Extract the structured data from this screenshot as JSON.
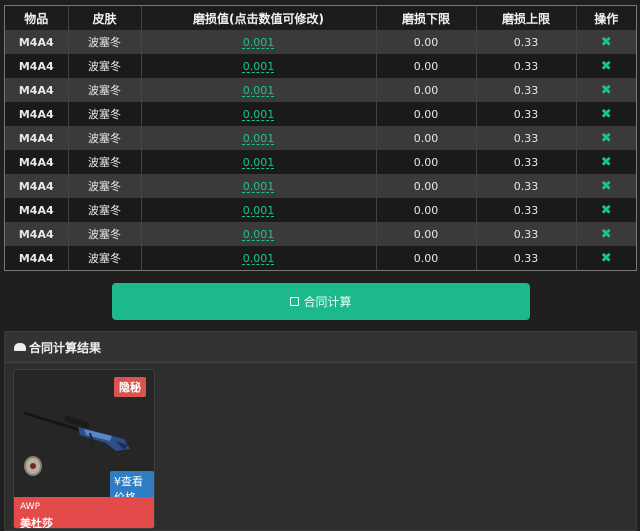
{
  "table": {
    "headers": {
      "item": "物品",
      "skin": "皮肤",
      "wear": "磨损值(点击数值可修改)",
      "wear_min": "磨损下限",
      "wear_max": "磨损上限",
      "action": "操作"
    },
    "rows": [
      {
        "item": "M4A4",
        "skin": "波塞冬",
        "wear": "0.001",
        "wear_min": "0.00",
        "wear_max": "0.33"
      },
      {
        "item": "M4A4",
        "skin": "波塞冬",
        "wear": "0.001",
        "wear_min": "0.00",
        "wear_max": "0.33"
      },
      {
        "item": "M4A4",
        "skin": "波塞冬",
        "wear": "0.001",
        "wear_min": "0.00",
        "wear_max": "0.33"
      },
      {
        "item": "M4A4",
        "skin": "波塞冬",
        "wear": "0.001",
        "wear_min": "0.00",
        "wear_max": "0.33"
      },
      {
        "item": "M4A4",
        "skin": "波塞冬",
        "wear": "0.001",
        "wear_min": "0.00",
        "wear_max": "0.33"
      },
      {
        "item": "M4A4",
        "skin": "波塞冬",
        "wear": "0.001",
        "wear_min": "0.00",
        "wear_max": "0.33"
      },
      {
        "item": "M4A4",
        "skin": "波塞冬",
        "wear": "0.001",
        "wear_min": "0.00",
        "wear_max": "0.33"
      },
      {
        "item": "M4A4",
        "skin": "波塞冬",
        "wear": "0.001",
        "wear_min": "0.00",
        "wear_max": "0.33"
      },
      {
        "item": "M4A4",
        "skin": "波塞冬",
        "wear": "0.001",
        "wear_min": "0.00",
        "wear_max": "0.33"
      },
      {
        "item": "M4A4",
        "skin": "波塞冬",
        "wear": "0.001",
        "wear_min": "0.00",
        "wear_max": "0.33"
      }
    ],
    "remove_icon": "close-icon"
  },
  "calculate_button": {
    "label": "合同计算",
    "icon": "calculator-icon"
  },
  "results": {
    "title": "合同计算结果",
    "icon": "briefcase-icon",
    "card": {
      "rarity": "隐秘",
      "price_button": "¥查看价格",
      "weapon_type": "AWP",
      "skin_name": "美杜莎"
    }
  },
  "colors": {
    "accent": "#1bb98b",
    "link": "#18c48f",
    "rarity": "#d9534f",
    "card_footer": "#e34b4b",
    "price_button": "#2f7ec4"
  }
}
